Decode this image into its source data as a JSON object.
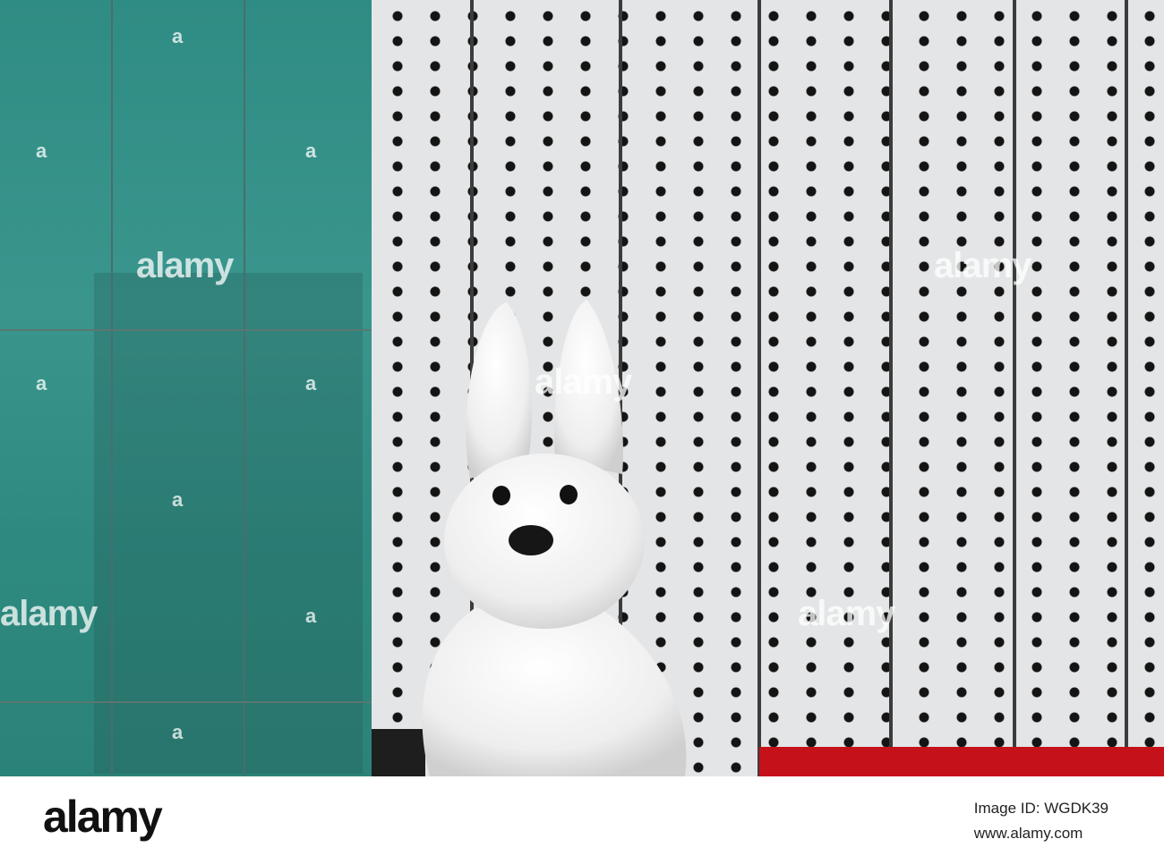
{
  "photo": {
    "subject": "white rabbit sculpture",
    "watermark_text": "alamy",
    "watermark_small": "a"
  },
  "footer": {
    "logo": "alamy",
    "image_id": "Image ID: WGDK39",
    "url": "www.alamy.com"
  },
  "colors": {
    "glass": "#2f8c84",
    "facade": "#e4e5e7",
    "dots": "#141414",
    "red_band": "#c5121a"
  }
}
